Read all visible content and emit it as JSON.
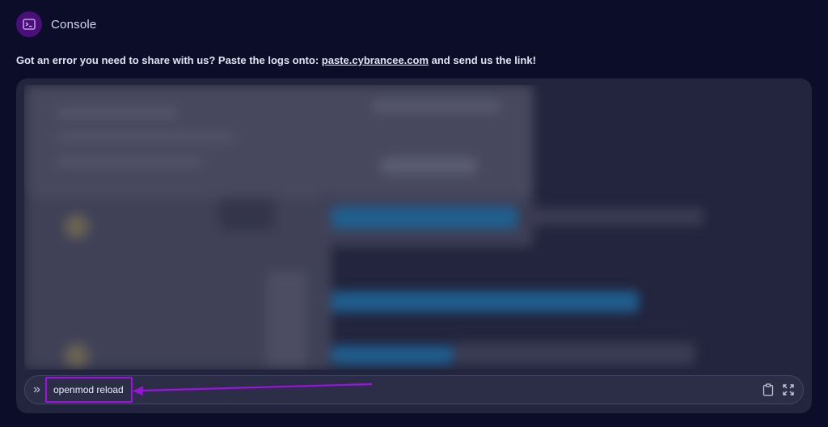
{
  "header": {
    "title": "Console",
    "icon": "terminal-icon"
  },
  "info": {
    "prefix": "Got an error you need to share with us? Paste the logs onto: ",
    "link_text": "paste.cybrancee.com",
    "suffix": " and send us the link!"
  },
  "console": {
    "input_value": "openmod reload",
    "prompt_icon": "»",
    "actions": [
      "clipboard-icon",
      "expand-icon"
    ]
  },
  "colors": {
    "background": "#0c0d29",
    "panel": "#23243d",
    "accent": "#9d12e0",
    "icon_bg": "#4a0f78"
  }
}
